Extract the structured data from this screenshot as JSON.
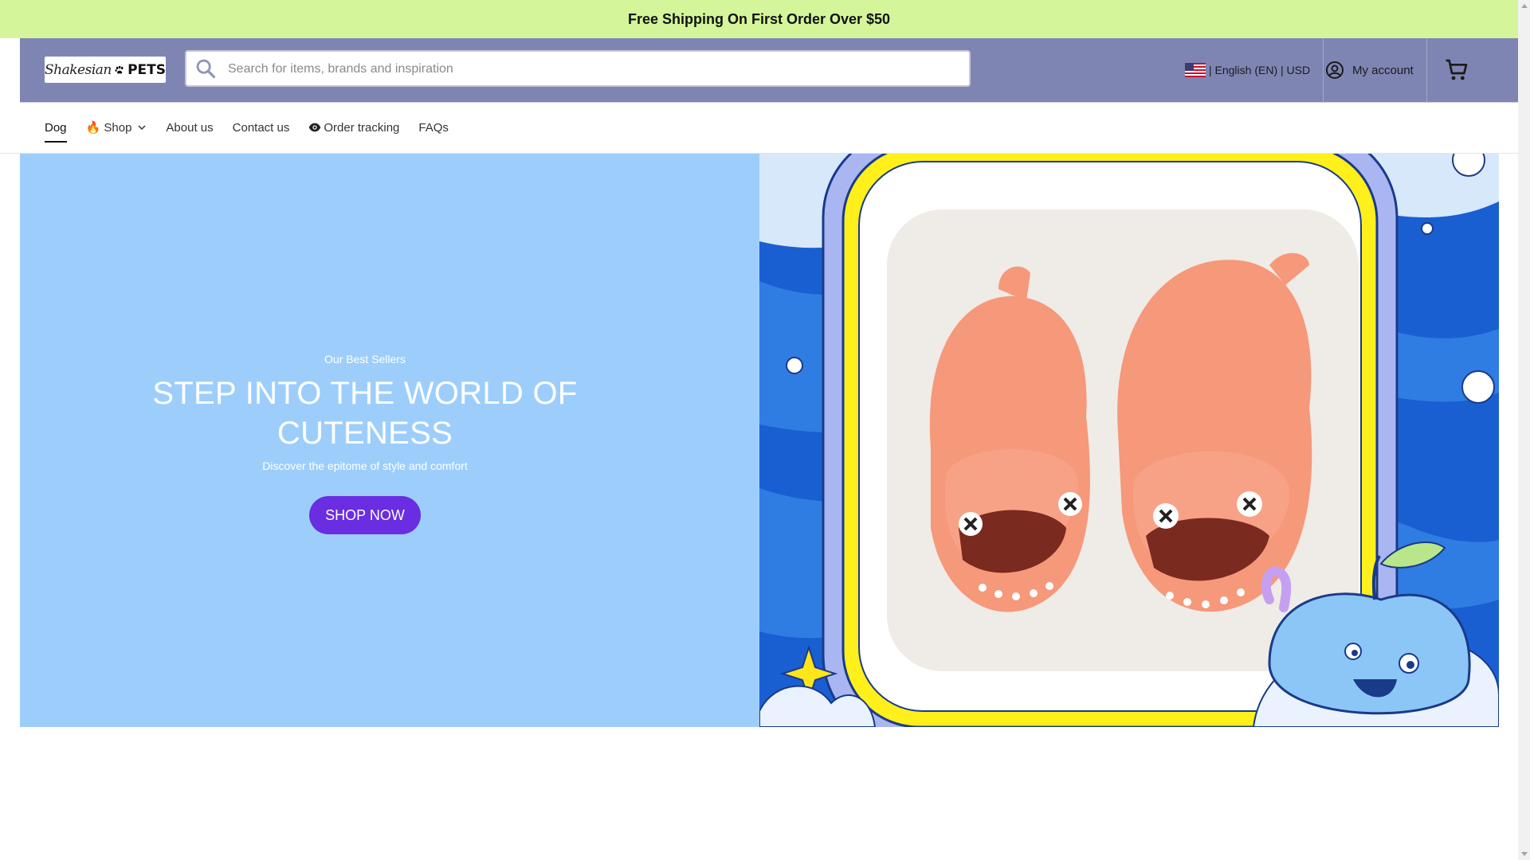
{
  "announcement": {
    "text": "Free Shipping On First Order Over $50"
  },
  "header": {
    "logo": {
      "script_text": "Shakesian",
      "bold_text": "PETS"
    },
    "search": {
      "placeholder": "Search for items, brands and inspiration",
      "value": ""
    },
    "locale": {
      "text": "| English (EN) | USD",
      "flag": "us-flag-icon"
    },
    "account": {
      "label": "My account",
      "icon": "account-circle-icon"
    },
    "cart": {
      "icon": "cart-icon"
    }
  },
  "nav": {
    "items": [
      {
        "label": "Dog",
        "active": true
      },
      {
        "label": "🔥 Shop",
        "has_dropdown": true
      },
      {
        "label": "About us"
      },
      {
        "label": "Contact us"
      },
      {
        "label": "Order tracking",
        "icon": "eye-icon"
      },
      {
        "label": "FAQs"
      }
    ]
  },
  "hero": {
    "kicker": "Our Best Sellers",
    "title": "STEP INTO THE WORLD OF CUTENESS",
    "subtitle": "Discover the epitome of style and comfort",
    "button_label": "SHOP NOW",
    "colors": {
      "left_bg": "#9dcefb",
      "button": "#6a2de2",
      "announce_bg": "#d5f59b",
      "header_bg": "#7f85b3"
    }
  }
}
